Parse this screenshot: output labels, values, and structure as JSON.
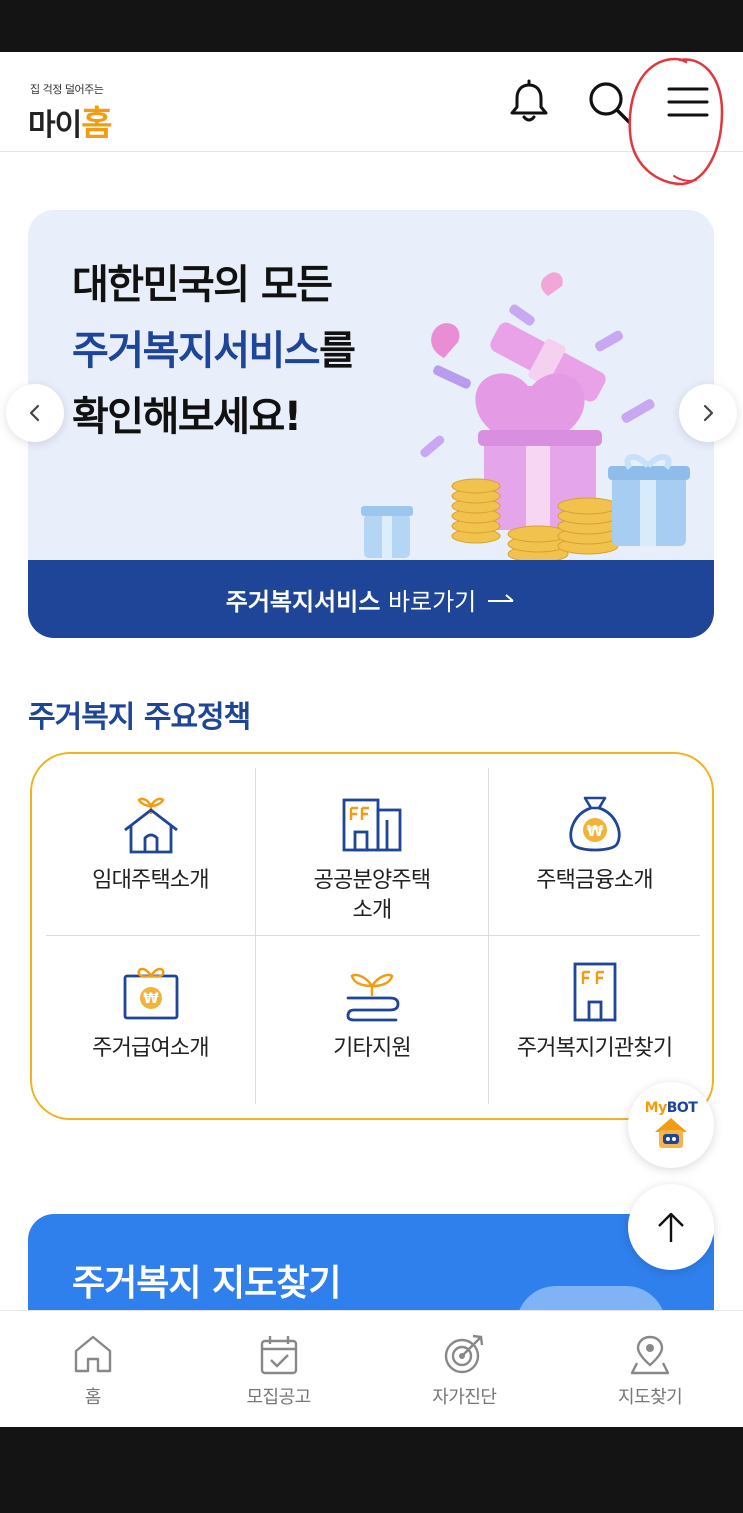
{
  "header": {
    "logo_tagline": "집 걱정 덜어주는",
    "logo_main_prefix": "마이",
    "logo_main_accent": "홈"
  },
  "banner": {
    "line1": "대한민국의 모든",
    "line2_blue": "주거복지서비스",
    "line2_suffix": "를",
    "line3": "확인해보세요!",
    "cta_bold": "주거복지서비스",
    "cta_rest": "바로가기"
  },
  "policies": {
    "title": "주거복지 주요정책",
    "items": [
      {
        "line1": "임대주택소개",
        "line2": "",
        "icon": "house-sprout-icon"
      },
      {
        "line1": "공공분양주택",
        "line2": "소개",
        "icon": "apartment-building-icon"
      },
      {
        "line1": "주택금융소개",
        "line2": "",
        "icon": "money-bag-icon"
      },
      {
        "line1": "주거급여소개",
        "line2": "",
        "icon": "won-gift-box-icon"
      },
      {
        "line1": "기타지원",
        "line2": "",
        "icon": "sprout-icon"
      },
      {
        "line1": "주거복지기관찾기",
        "line2": "",
        "icon": "office-building-icon"
      }
    ]
  },
  "mybot": {
    "label_prefix": "My",
    "label_suffix": "BOT"
  },
  "map_card": {
    "title": "주거복지 지도찾기"
  },
  "bottom_nav": [
    {
      "label": "홈",
      "icon": "home-icon"
    },
    {
      "label": "모집공고",
      "icon": "calendar-check-icon"
    },
    {
      "label": "자가진단",
      "icon": "target-icon"
    },
    {
      "label": "지도찾기",
      "icon": "map-pin-icon"
    }
  ],
  "colors": {
    "brand_blue": "#1e4597",
    "accent_orange": "#f39c12",
    "policy_border": "#f0b21f",
    "map_blue": "#2f80ed"
  }
}
